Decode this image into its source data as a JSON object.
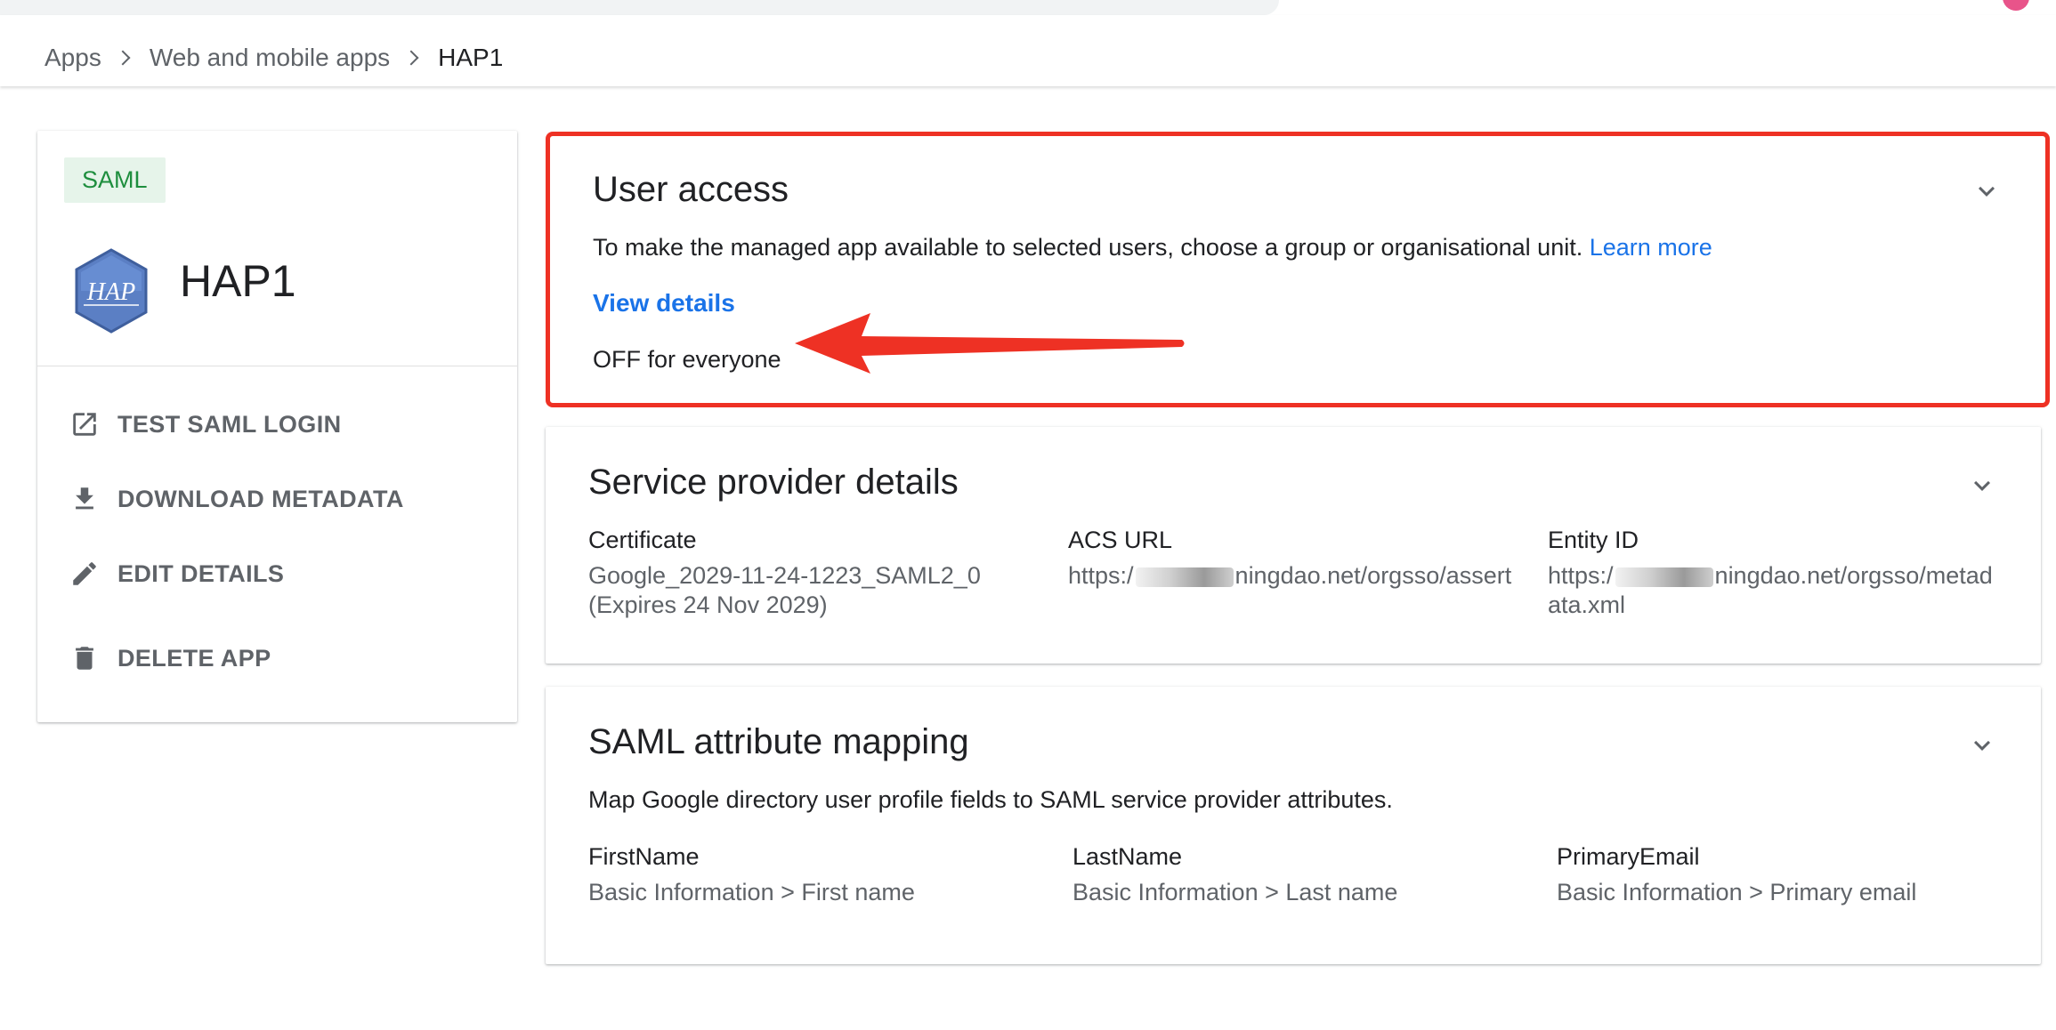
{
  "breadcrumb": {
    "items": [
      "Apps",
      "Web and mobile apps",
      "HAP1"
    ]
  },
  "app": {
    "badge": "SAML",
    "logo_text": "HAP",
    "name": "HAP1"
  },
  "actions": {
    "test_saml_login": "TEST SAML LOGIN",
    "download_metadata": "DOWNLOAD METADATA",
    "edit_details": "EDIT DETAILS",
    "delete_app": "DELETE APP"
  },
  "user_access": {
    "title": "User access",
    "description": "To make the managed app available to selected users, choose a group or organisational unit.",
    "learn_more": "Learn more",
    "view_details": "View details",
    "status": "OFF for everyone"
  },
  "service_provider": {
    "title": "Service provider details",
    "certificate_label": "Certificate",
    "certificate_value": "Google_2029-11-24-1223_SAML2_0",
    "certificate_expiry": "(Expires 24 Nov 2029)",
    "acs_label": "ACS URL",
    "acs_prefix": "https:/",
    "acs_suffix": "ningdao.net/orgsso/assert",
    "entity_label": "Entity ID",
    "entity_prefix": "https:/",
    "entity_suffix": "ningdao.net/orgsso/metadata.xml"
  },
  "attribute_mapping": {
    "title": "SAML attribute mapping",
    "description": "Map Google directory user profile fields to SAML service provider attributes.",
    "mappings": [
      {
        "name": "FirstName",
        "value": "Basic Information > First name"
      },
      {
        "name": "LastName",
        "value": "Basic Information > Last name"
      },
      {
        "name": "PrimaryEmail",
        "value": "Basic Information > Primary email"
      }
    ]
  },
  "colors": {
    "accent_link": "#1a73e8",
    "badge_green": "#1e8e3e",
    "highlight_red": "#ee3124"
  }
}
